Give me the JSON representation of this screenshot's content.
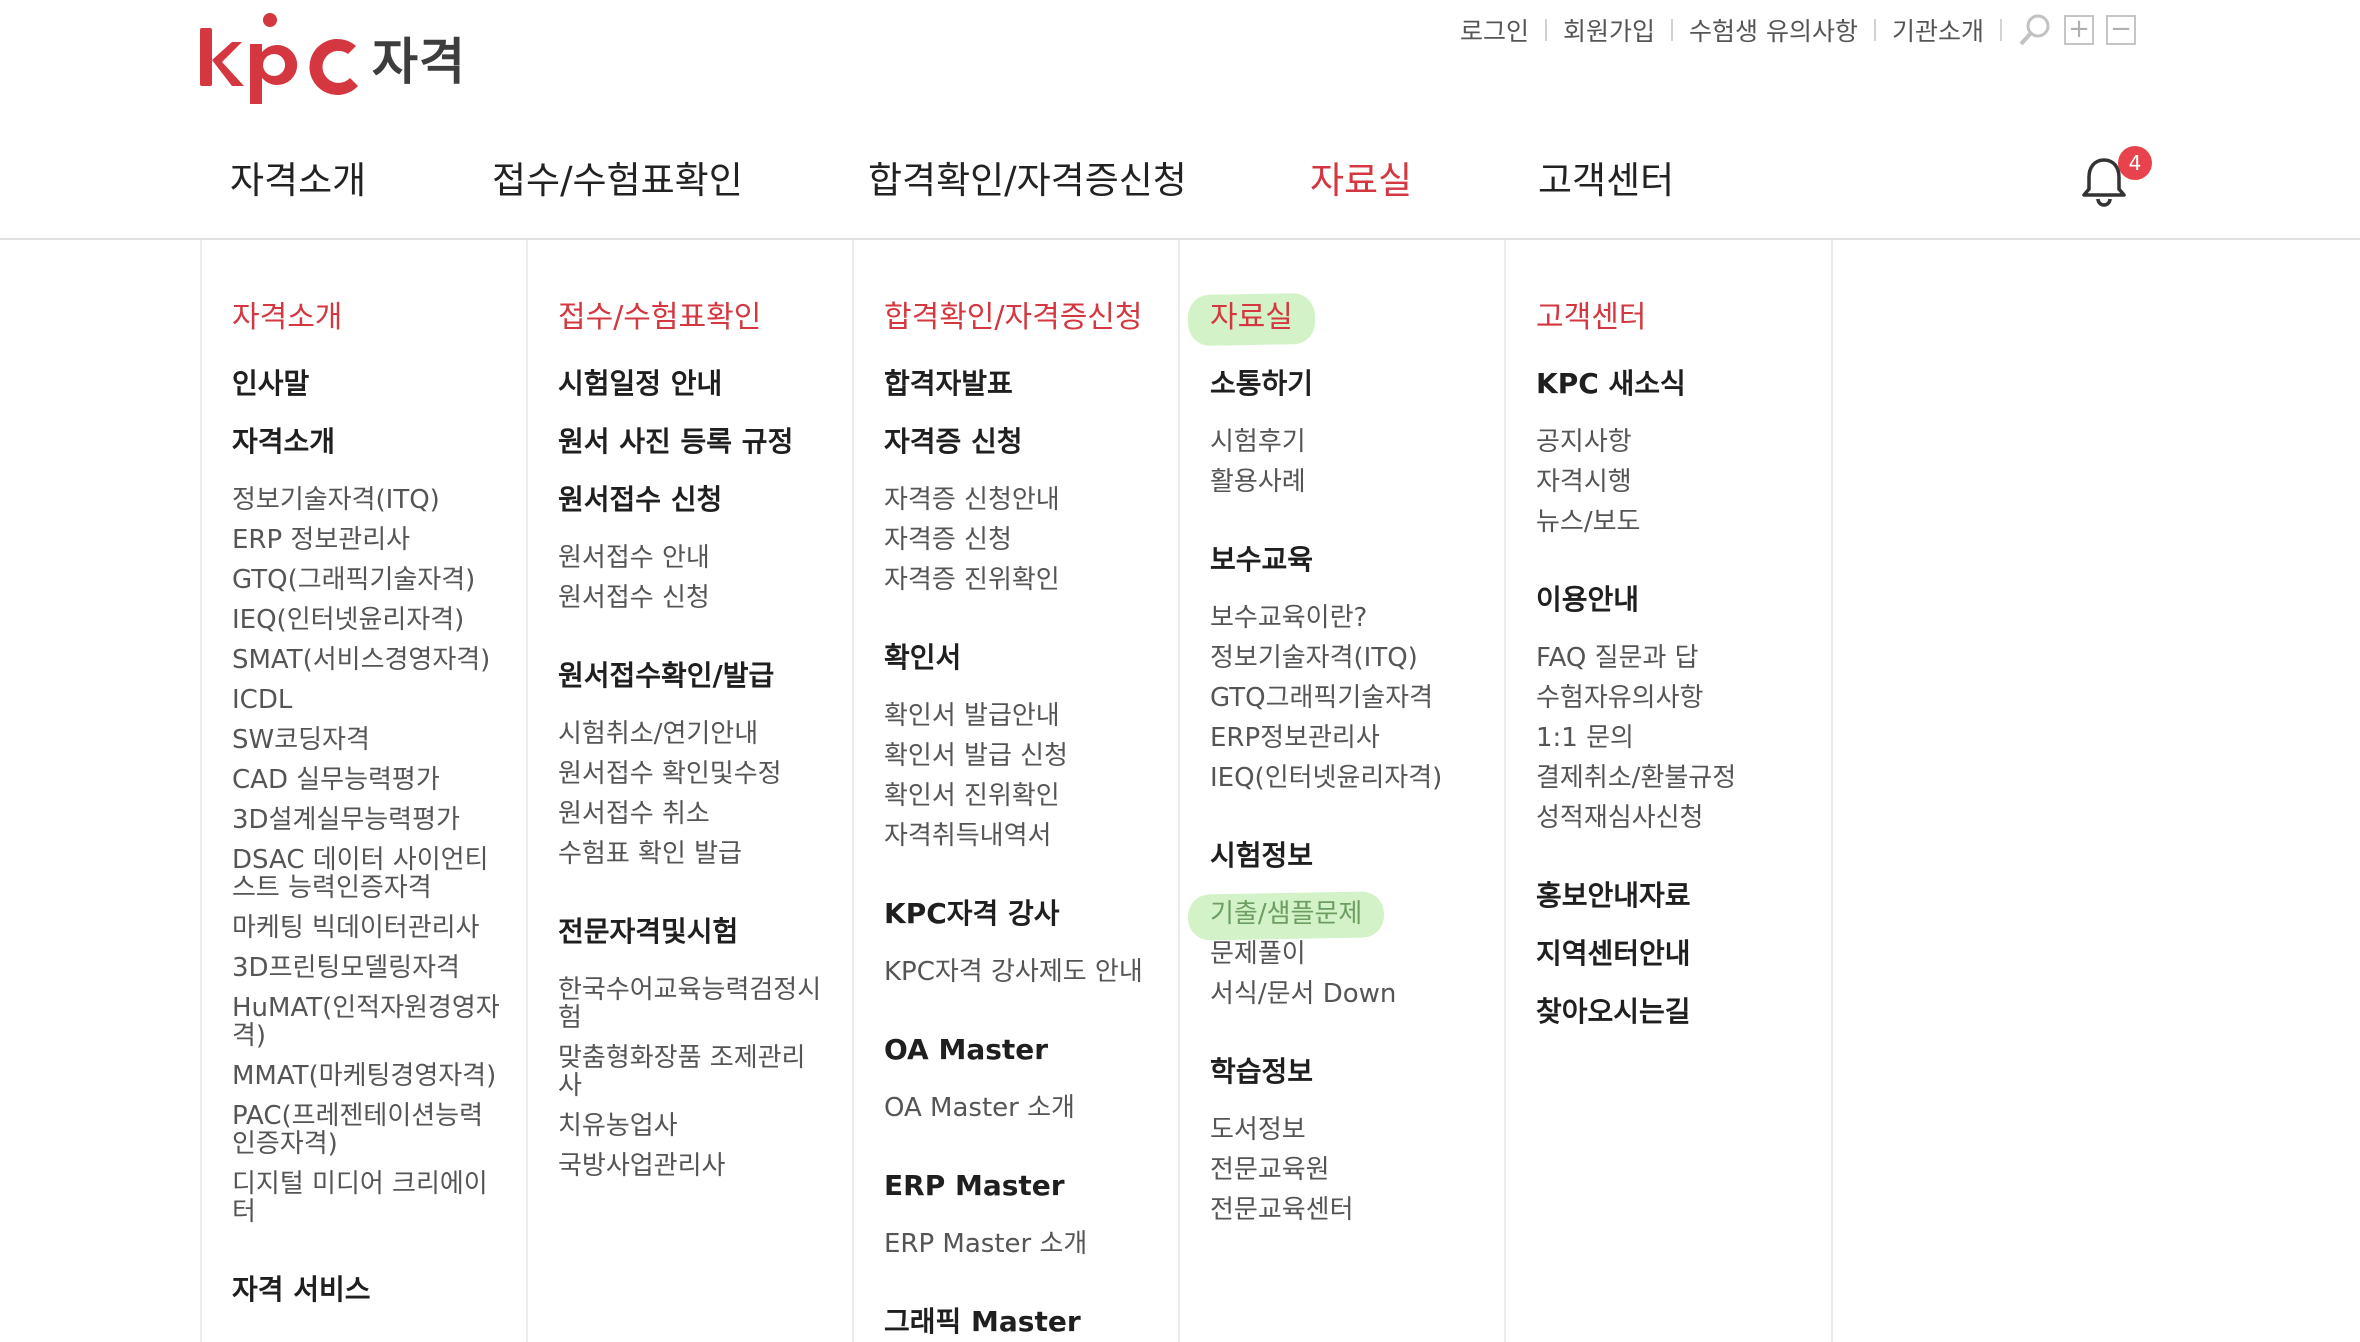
{
  "logo": {
    "brand": "kpc",
    "text": "자격"
  },
  "util_nav": [
    "로그인",
    "회원가입",
    "수험생 유의사항",
    "기관소개"
  ],
  "gnb": [
    "자격소개",
    "접수/수험표확인",
    "합격확인/자격증신청",
    "자료실",
    "고객센터"
  ],
  "notification_count": "4",
  "colors": {
    "accent": "#d4373f",
    "highlight": "#8cdc6e"
  },
  "icons": [
    "search-icon",
    "zoom-in-icon",
    "zoom-out-icon",
    "bell-icon"
  ],
  "menu": {
    "col1": {
      "title": "자격소개",
      "sections": [
        {
          "label": "인사말",
          "items": []
        },
        {
          "label": "자격소개",
          "items": [
            "정보기술자격(ITQ)",
            "ERP 정보관리사",
            "GTQ(그래픽기술자격)",
            "IEQ(인터넷윤리자격)",
            "SMAT(서비스경영자격)",
            "ICDL",
            "SW코딩자격",
            "CAD 실무능력평가",
            "3D설계실무능력평가",
            "DSAC 데이터 사이언티스트 능력인증자격",
            "마케팅 빅데이터관리사",
            "3D프린팅모델링자격",
            "HuMAT(인적자원경영자격)",
            "MMAT(마케팅경영자격)",
            "PAC(프레젠테이션능력인증자격)",
            "디지털 미디어 크리에이터"
          ]
        },
        {
          "label": "자격 서비스",
          "items": []
        }
      ]
    },
    "col2": {
      "title": "접수/수험표확인",
      "sections": [
        {
          "label": "시험일정 안내",
          "items": []
        },
        {
          "label": "원서 사진 등록 규정",
          "items": []
        },
        {
          "label": "원서접수 신청",
          "items": [
            "원서접수 안내",
            "원서접수 신청"
          ]
        },
        {
          "label": "원서접수확인/발급",
          "items": [
            "시험취소/연기안내",
            "원서접수 확인및수정",
            "원서접수 취소",
            "수험표 확인 발급"
          ]
        },
        {
          "label": "전문자격및시험",
          "items": [
            "한국수어교육능력검정시험",
            "맞춤형화장품 조제관리사",
            "치유농업사",
            "국방사업관리사"
          ]
        }
      ]
    },
    "col3": {
      "title": "합격확인/자격증신청",
      "sections": [
        {
          "label": "합격자발표",
          "items": []
        },
        {
          "label": "자격증 신청",
          "items": [
            "자격증 신청안내",
            "자격증 신청",
            "자격증 진위확인"
          ]
        },
        {
          "label": "확인서",
          "items": [
            "확인서 발급안내",
            "확인서 발급 신청",
            "확인서 진위확인",
            "자격취득내역서"
          ]
        },
        {
          "label": "KPC자격 강사",
          "items": [
            "KPC자격 강사제도 안내"
          ]
        },
        {
          "label": "OA Master",
          "items": [
            "OA Master 소개"
          ]
        },
        {
          "label": "ERP Master",
          "items": [
            "ERP Master 소개"
          ]
        },
        {
          "label": "그래픽 Master",
          "items": []
        }
      ]
    },
    "col4": {
      "title": "자료실",
      "sections": [
        {
          "label": "소통하기",
          "items": [
            "시험후기",
            "활용사례"
          ]
        },
        {
          "label": "보수교육",
          "items": [
            "보수교육이란?",
            "정보기술자격(ITQ)",
            "GTQ그래픽기술자격",
            "ERP정보관리사",
            "IEQ(인터넷윤리자격)"
          ]
        },
        {
          "label": "시험정보",
          "items": [
            "기출/샘플문제",
            "문제풀이",
            "서식/문서 Down"
          ]
        },
        {
          "label": "학습정보",
          "items": [
            "도서정보",
            "전문교육원",
            "전문교육센터"
          ]
        }
      ]
    },
    "col5": {
      "title": "고객센터",
      "sections": [
        {
          "label": "KPC 새소식",
          "items": [
            "공지사항",
            "자격시행",
            "뉴스/보도"
          ]
        },
        {
          "label": "이용안내",
          "items": [
            "FAQ 질문과 답",
            "수험자유의사항",
            "1:1 문의",
            "결제취소/환불규정",
            "성적재심사신청"
          ]
        },
        {
          "label": "홍보안내자료",
          "items": []
        },
        {
          "label": "지역센터안내",
          "items": []
        },
        {
          "label": "찾아오시는길",
          "items": []
        }
      ]
    }
  }
}
